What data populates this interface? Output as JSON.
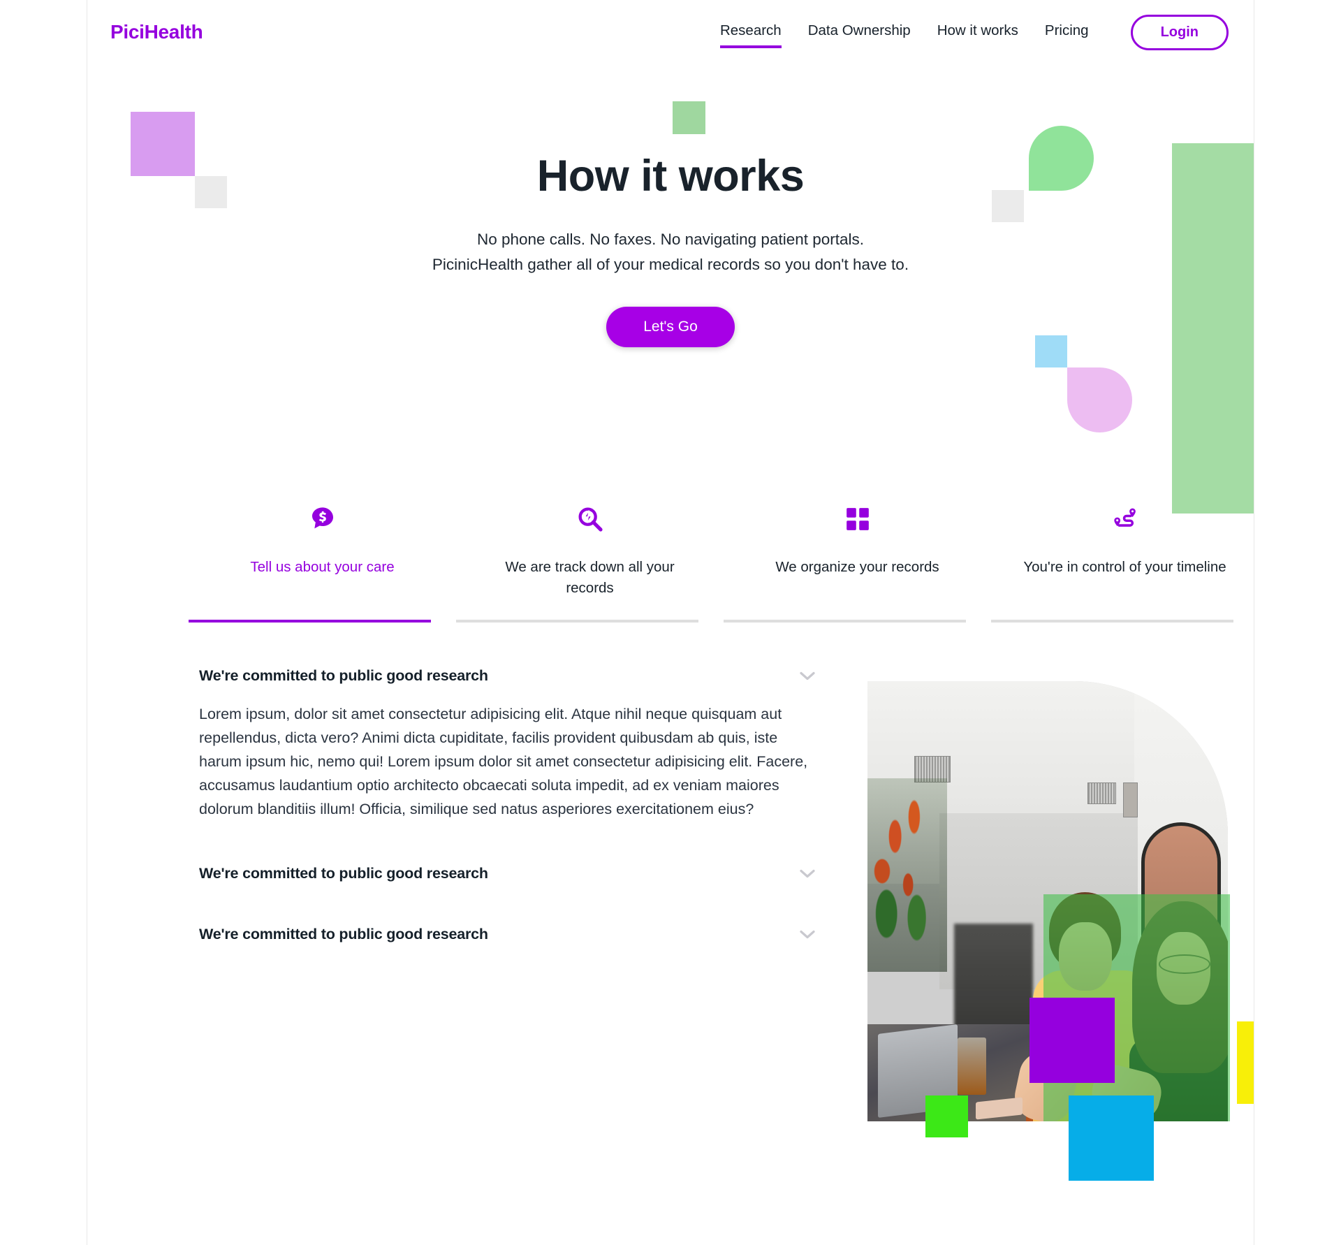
{
  "header": {
    "logo": "PiciHealth",
    "nav": [
      {
        "label": "Research",
        "active": true
      },
      {
        "label": "Data Ownership",
        "active": false
      },
      {
        "label": "How it works",
        "active": false
      },
      {
        "label": "Pricing",
        "active": false
      }
    ],
    "login_label": "Login"
  },
  "hero": {
    "title": "How it works",
    "subtitle_line1": "No phone calls. No faxes. No navigating patient portals.",
    "subtitle_line2": "PicinicHealth gather all of your medical records so you don't have to.",
    "cta_label": "Let's Go"
  },
  "steps": [
    {
      "label": "Tell us about your care",
      "icon": "chat-dollar-icon",
      "active": true
    },
    {
      "label": "We are track down all your records",
      "icon": "search-bolt-icon",
      "active": false
    },
    {
      "label": "We organize your records",
      "icon": "grid-squares-icon",
      "active": false
    },
    {
      "label": "You're in control of your timeline",
      "icon": "route-pins-icon",
      "active": false
    }
  ],
  "accordion": [
    {
      "title": "We're committed to public good research",
      "body": "Lorem ipsum, dolor sit amet consectetur adipisicing elit. Atque nihil neque quisquam aut repellendus, dicta vero? Animi dicta cupiditate, facilis provident quibusdam ab quis, iste harum ipsum hic, nemo qui! Lorem ipsum dolor sit amet consectetur adipisicing elit. Facere, accusamus laudantium optio architecto obcaecati soluta impedit, ad ex veniam maiores dolorum blanditiis illum! Officia, similique sed natus asperiores exercitationem eius?",
      "expanded": true
    },
    {
      "title": "We're committed to public good research",
      "expanded": false
    },
    {
      "title": "We're committed to public good research",
      "expanded": false
    }
  ],
  "colors": {
    "brand_purple": "#9500de",
    "cta_purple": "#a700e6",
    "decor_light_purple": "#d89cf0",
    "decor_gray": "#ebebeb",
    "decor_green": "#9fd79f",
    "decor_green_drop": "#90e39a",
    "decor_green_bar": "#a4dca4",
    "decor_blue": "#9fdcf7",
    "decor_pink_drop": "#edbdf2",
    "block_purple": "#9500de",
    "block_yellow": "#f8ef08",
    "block_lime": "#3ce817",
    "block_cyan": "#06ade8",
    "text_dark": "#19222b",
    "rule_inactive": "#dedede",
    "chevron_gray": "#c9c9cf"
  },
  "photo": {
    "alt": "Two women working on laptops at a table in a modern office"
  }
}
